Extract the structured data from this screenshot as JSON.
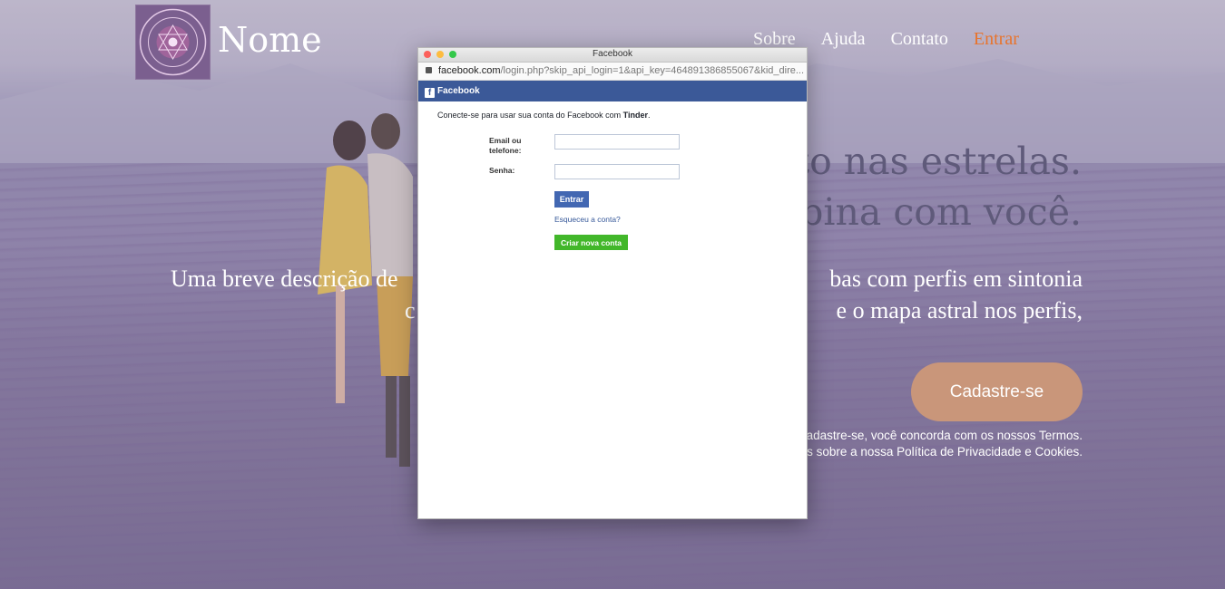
{
  "site": {
    "brand": "Nome",
    "nav": [
      {
        "label": "Sobre",
        "active": false
      },
      {
        "label": "Ajuda",
        "active": false
      },
      {
        "label": "Contato",
        "active": false
      },
      {
        "label": "Entrar",
        "active": true
      }
    ],
    "headline": [
      "ito nas estrelas.",
      "nbina com você."
    ],
    "description": [
      "Uma breve descrição de",
      "bas com perfis em sintonia",
      "c",
      "e o mapa astral nos perfis,"
    ],
    "cta_label": "Cadastre-se",
    "terms": [
      "adastre-se, você concorda com os nossos Termos.",
      "is sobre a nossa Política de Privacidade e Cookies."
    ],
    "colors": {
      "accent": "#e8732c",
      "cta": "#c9967a",
      "headline": "#5f5a7a"
    }
  },
  "popup": {
    "window_title": "Facebook",
    "url_host": "facebook.com",
    "url_path": "/login.php?skip_api_login=1&api_key=464891386855067&kid_dire...",
    "header_label": "Facebook",
    "prompt_prefix": "Conecte-se para usar sua conta do Facebook com",
    "prompt_app": "Tinder",
    "prompt_suffix": ".",
    "email_label_1": "Email ou",
    "email_label_2": "telefone:",
    "password_label": "Senha:",
    "login_button": "Entrar",
    "forgot_link": "Esqueceu a conta?",
    "create_button": "Criar nova conta",
    "colors": {
      "fb_blue": "#3b5998",
      "create_green": "#42b72a"
    }
  }
}
